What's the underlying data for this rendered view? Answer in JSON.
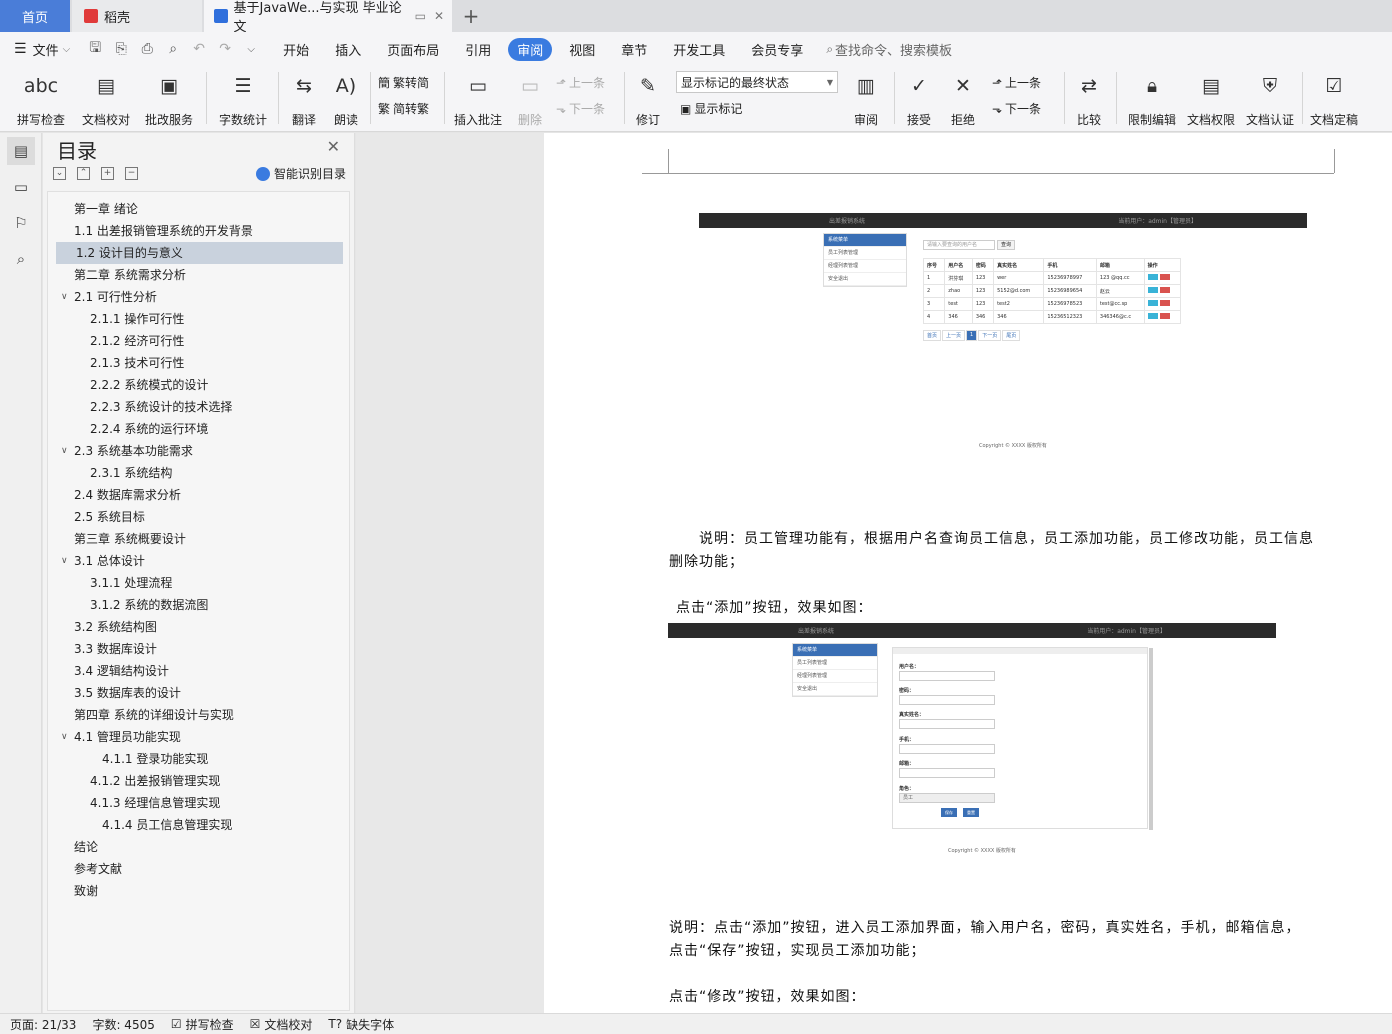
{
  "tabs": {
    "home": "首页",
    "daoke": "稻壳",
    "doc": "基于JavaWe...与实现 毕业论文",
    "add": "+"
  },
  "menu": {
    "file": "文件",
    "items": [
      "开始",
      "插入",
      "页面布局",
      "引用",
      "审阅",
      "视图",
      "章节",
      "开发工具",
      "会员专享"
    ],
    "active_index": 4,
    "search": "查找命令、搜索模板"
  },
  "ribbon": {
    "spell": "拼写检查",
    "doc_check": "文档校对",
    "batch": "批改服务",
    "word_count": "字数统计",
    "translate": "翻译",
    "read": "朗读",
    "to_trad": "繁转简",
    "to_simp": "简转繁",
    "insert_comment": "插入批注",
    "delete": "删除",
    "prev": "上一条",
    "next": "下一条",
    "revise": "修订",
    "markup_select": "显示标记的最终状态",
    "show_markup": "显示标记",
    "review": "审阅",
    "accept": "接受",
    "reject": "拒绝",
    "prev2": "上一条",
    "next2": "下一条",
    "compare": "比较",
    "restrict": "限制编辑",
    "doc_perm": "文档权限",
    "doc_cert": "文档认证",
    "doc_final": "文档定稿"
  },
  "toc": {
    "title": "目录",
    "smart": "智能识别目录",
    "items": [
      {
        "text": "第一章  绪论",
        "level": 1
      },
      {
        "text": "1.1  出差报销管理系统的开发背景",
        "level": 1
      },
      {
        "text": "1.2 设计目的与意义",
        "level": 1,
        "selected": true
      },
      {
        "text": "第二章  系统需求分析",
        "level": 1
      },
      {
        "text": "2.1  可行性分析",
        "level": 1,
        "expand": true
      },
      {
        "text": "2.1.1  操作可行性",
        "level": 2
      },
      {
        "text": "2.1.2  经济可行性",
        "level": 2
      },
      {
        "text": "2.1.3  技术可行性",
        "level": 2
      },
      {
        "text": "2.2.2  系统模式的设计",
        "level": 2
      },
      {
        "text": "2.2.3 系统设计的技术选择",
        "level": 2
      },
      {
        "text": "2.2.4 系统的运行环境",
        "level": 2
      },
      {
        "text": "2.3  系统基本功能需求",
        "level": 1,
        "expand": true
      },
      {
        "text": "2.3.1  系统结构",
        "level": 2
      },
      {
        "text": "2.4 数据库需求分析",
        "level": 1
      },
      {
        "text": "2.5  系统目标",
        "level": 1
      },
      {
        "text": "第三章  系统概要设计",
        "level": 1
      },
      {
        "text": "3.1 总体设计",
        "level": 1,
        "expand": true
      },
      {
        "text": "3.1.1  处理流程",
        "level": 2
      },
      {
        "text": "3.1.2 系统的数据流图",
        "level": 2
      },
      {
        "text": "3.2  系统结构图",
        "level": 1
      },
      {
        "text": "3.3 数据库设计",
        "level": 1
      },
      {
        "text": "3.4 逻辑结构设计",
        "level": 1
      },
      {
        "text": "3.5 数据库表的设计",
        "level": 1
      },
      {
        "text": "第四章  系统的详细设计与实现",
        "level": 1
      },
      {
        "text": "4.1  管理员功能实现",
        "level": 1,
        "expand": true
      },
      {
        "text": "4.1.1  登录功能实现",
        "level": 3
      },
      {
        "text": "4.1.2  出差报销管理实现",
        "level": 2
      },
      {
        "text": "4.1.3  经理信息管理实现",
        "level": 2
      },
      {
        "text": "4.1.4  员工信息管理实现",
        "level": 3
      },
      {
        "text": "结论",
        "level": 1
      },
      {
        "text": "参考文献",
        "level": 1
      },
      {
        "text": "致谢",
        "level": 1
      }
    ]
  },
  "document": {
    "para1_line1": "说明：员工管理功能有，根据用户名查询员工信息，员工添加功能，员工修改功能，员工信息",
    "para1_line2": "删除功能；",
    "para2": "点击“添加”按钮，效果如图：",
    "para3_line1": "说明：点击“添加”按钮，进入员工添加界面，输入用户名，密码，真实姓名，手机，邮箱信息，",
    "para3_line2": "点击“保存”按钮，实现员工添加功能；",
    "para4": "点击“修改”按钮，效果如图："
  },
  "shot1": {
    "title_left": "出差报销系统",
    "title_right": "当前用户：admin【管理员】",
    "menu": [
      "系统菜单",
      "员工列表管理",
      "经理列表管理",
      "安全退出"
    ],
    "search_placeholder": "请输入要查询的用户名",
    "search_btn": "查询",
    "headers": [
      "序号",
      "用户名",
      "密码",
      "真实姓名",
      "手机",
      "邮箱",
      "操作"
    ],
    "rows": [
      [
        "1",
        "洪芬琪",
        "123",
        "wer",
        "15236978997",
        "123 @qq.cc"
      ],
      [
        "2",
        "zhao",
        "123",
        "5152@d.com",
        "15236989654",
        "赵云"
      ],
      [
        "3",
        "test",
        "123",
        "test2",
        "15236978523",
        "test@cc.sp"
      ],
      [
        "4",
        "346",
        "346",
        "346",
        "15236512323",
        "346346@c.c"
      ]
    ],
    "pager": [
      "首页",
      "上一页",
      "1",
      "下一页",
      "尾页"
    ],
    "copyright": "Copyright © XXXX 版权所有"
  },
  "shot2": {
    "title_left": "出差报销系统",
    "title_right": "当前用户：admin【管理员】",
    "menu": [
      "系统菜单",
      "员工列表管理",
      "经理列表管理",
      "安全退出"
    ],
    "labels": [
      "用户名：",
      "密码：",
      "真实姓名：",
      "手机：",
      "邮箱：",
      "角色："
    ],
    "role_value": "员工",
    "save": "保存",
    "reset": "重置",
    "copyright": "Copyright © XXXX 版权所有"
  },
  "status": {
    "page": "页面: 21/33",
    "words": "字数: 4505",
    "spell": "拼写检查",
    "check": "文档校对",
    "font": "缺失字体"
  }
}
